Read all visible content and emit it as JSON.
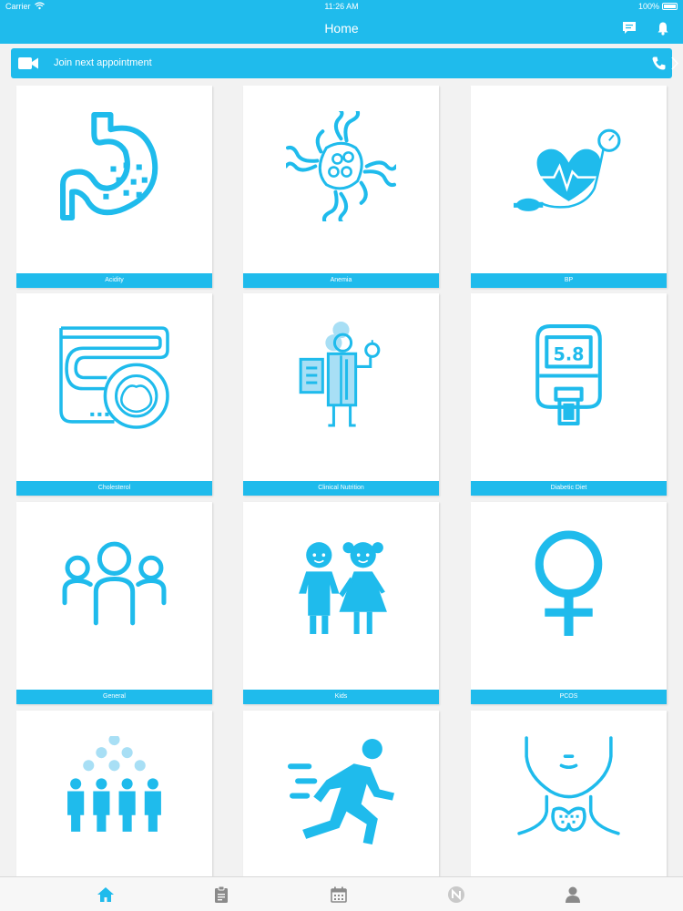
{
  "status_bar": {
    "carrier": "Carrier",
    "time": "11:26 AM",
    "battery": "100%"
  },
  "nav": {
    "title": "Home",
    "icons": [
      "chat-icon",
      "bell-icon"
    ]
  },
  "appointment": {
    "label": "Join next appointment",
    "icons": [
      "video-camera-icon",
      "phone-icon",
      "chevron-right-icon"
    ]
  },
  "tiles": [
    {
      "label": "Acidity",
      "icon": "stomach-icon"
    },
    {
      "label": "Anemia",
      "icon": "blood-cells-icon"
    },
    {
      "label": "BP",
      "icon": "heart-pressure-gauge-icon"
    },
    {
      "label": "Cholesterol",
      "icon": "artery-icon"
    },
    {
      "label": "Clinical Nutrition",
      "icon": "nutritionist-icon"
    },
    {
      "label": "Diabetic Diet",
      "icon": "glucometer-icon",
      "reading": "5.8"
    },
    {
      "label": "General",
      "icon": "people-group-icon"
    },
    {
      "label": "Kids",
      "icon": "kids-icon"
    },
    {
      "label": "PCOS",
      "icon": "female-symbol-icon"
    },
    {
      "label": "",
      "icon": "crowd-icon"
    },
    {
      "label": "",
      "icon": "runner-icon"
    },
    {
      "label": "",
      "icon": "thyroid-icon"
    }
  ],
  "tab_bar": {
    "tabs": [
      "home-icon",
      "clipboard-icon",
      "calendar-icon",
      "nutrition-logo-icon",
      "profile-icon"
    ],
    "active": "home-icon"
  },
  "colors": {
    "accent": "#1fbbec",
    "tile_bg": "#ffffff",
    "page_bg": "#f2f2f2",
    "tab_active": "#1fbbec",
    "tab_inactive": "#8a8a8a"
  }
}
